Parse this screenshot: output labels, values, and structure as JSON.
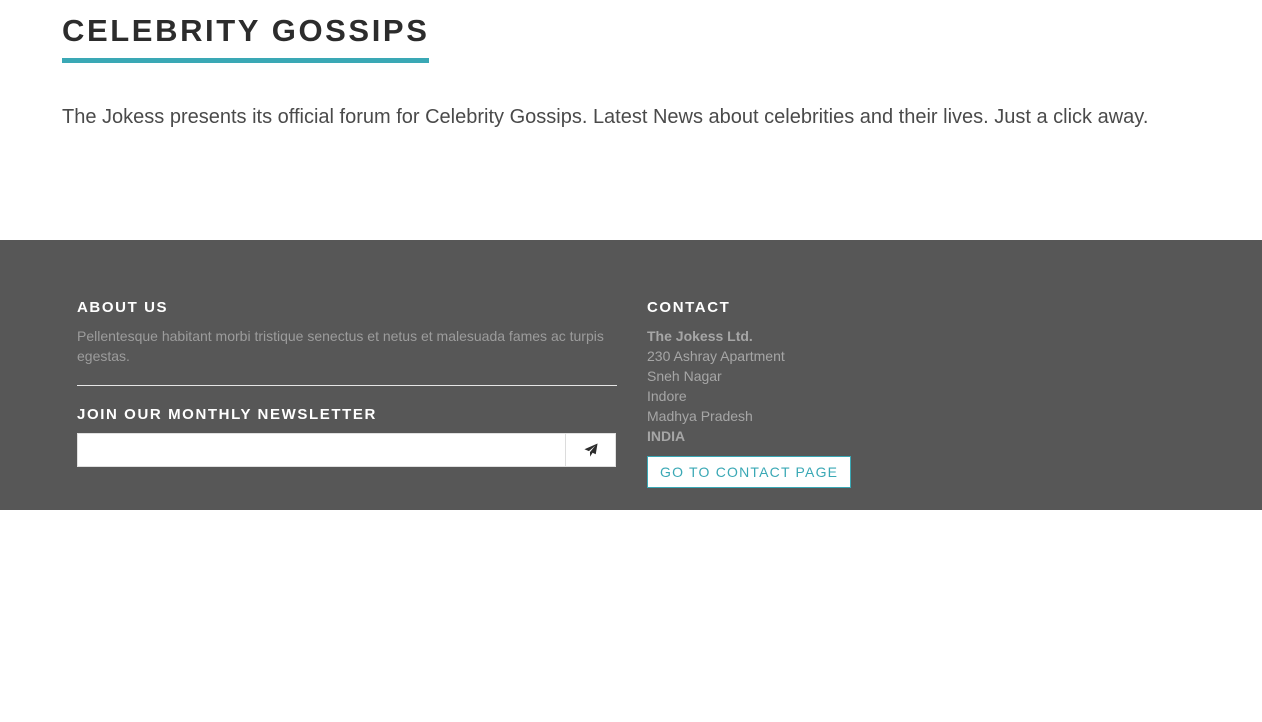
{
  "main": {
    "title": "CELEBRITY GOSSIPS",
    "intro": "The Jokess presents its official forum for Celebrity Gossips. Latest News about celebrities and their lives. Just a click away."
  },
  "footer": {
    "about": {
      "heading": "ABOUT US",
      "text": "Pellentesque habitant morbi tristique senectus et netus et malesuada fames ac turpis egestas."
    },
    "newsletter": {
      "heading": "JOIN OUR MONTHLY NEWSLETTER",
      "input_value": "",
      "placeholder": "",
      "submit_icon": "paper-plane-icon"
    },
    "contact": {
      "heading": "CONTACT",
      "company": "The Jokess Ltd.",
      "address_line1": "230 Ashray Apartment",
      "address_line2": "Sneh Nagar",
      "city": "Indore",
      "state": "Madhya Pradesh",
      "country": "INDIA",
      "button_label": "GO TO CONTACT PAGE"
    }
  },
  "colors": {
    "accent": "#3aa8b5",
    "footer_bg": "#575757",
    "heading_text": "#2c2c2c",
    "footer_muted_text": "#9c9c9c"
  }
}
